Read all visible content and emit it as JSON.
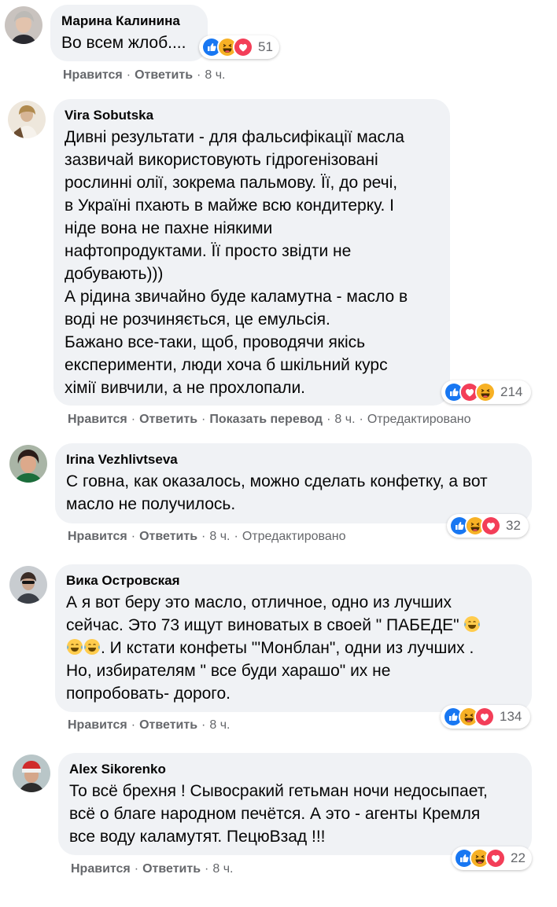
{
  "comments": [
    {
      "author": "Марина Калинина",
      "text": "Во всем жлоб....",
      "reactions": [
        "like-icon",
        "haha-icon",
        "love-icon"
      ],
      "reaction_count": "51",
      "like": "Нравится",
      "reply": "Ответить",
      "time": "8 ч."
    },
    {
      "author": "Vira Sobutska",
      "text": "Дивні результати - для фальсифікації масла\nзазвичай використовують гідрогенізовані\nрослинні олії, зокрема пальмову. Її, до речі,\nв Україні пхають в майже всю кондитерку. І\nніде вона не пахне ніякими\nнафтопродуктами. Її просто звідти не\nдобувають)))\nА рідина звичайно буде каламутна - масло в\nводі не розчиняється, це емульсія.\nБажано все-таки, щоб, проводячи якісь\nексперименти, люди хоча б шкільний курс\nхімії вивчили, а не прохлопали.",
      "reactions": [
        "like-icon",
        "love-icon",
        "haha-icon"
      ],
      "reaction_count": "214",
      "like": "Нравится",
      "reply": "Ответить",
      "translate": "Показать перевод",
      "time": "8 ч.",
      "edited": "Отредактировано"
    },
    {
      "author": "Irina Vezhlivtseva",
      "text": "С говна, как оказалось, можно сделать конфетку, а вот\nмасло не получилось.",
      "reactions": [
        "like-icon",
        "haha-icon",
        "love-icon"
      ],
      "reaction_count": "32",
      "like": "Нравится",
      "reply": "Ответить",
      "time": "8 ч.",
      "edited": "Отредактировано"
    },
    {
      "author": "Вика Островская",
      "text_parts": [
        "А я вот беру это масло, отличное, одно из лучших\nсейчас. Это 73 ищут виноватых в своей \" ПАБЕДЕ\" ",
        ". И кстати конфеты \"'Монблан\", одни из лучших .\nНо, избирателям \" все буди харашо\" их не\nпопробовать- дорого."
      ],
      "reactions": [
        "like-icon",
        "haha-icon",
        "love-icon"
      ],
      "reaction_count": "134",
      "like": "Нравится",
      "reply": "Ответить",
      "time": "8 ч."
    },
    {
      "author": "Alex Sikorenko",
      "text": "То всё брехня ! Сывосракий гетьман ночи недосыпает,\nвсё о благе народном печётся. А это - агенты Кремля\nвсе воду каламутят. ПецюВзад !!!",
      "reactions": [
        "like-icon",
        "haha-icon",
        "love-icon"
      ],
      "reaction_count": "22",
      "like": "Нравится",
      "reply": "Ответить",
      "time": "8 ч."
    }
  ],
  "colors": {
    "bubble": "#f0f2f5",
    "meta": "#65676b",
    "like_blue": "#1877f2",
    "love_red": "#f33e58",
    "haha_yellow": "#f7b125"
  }
}
